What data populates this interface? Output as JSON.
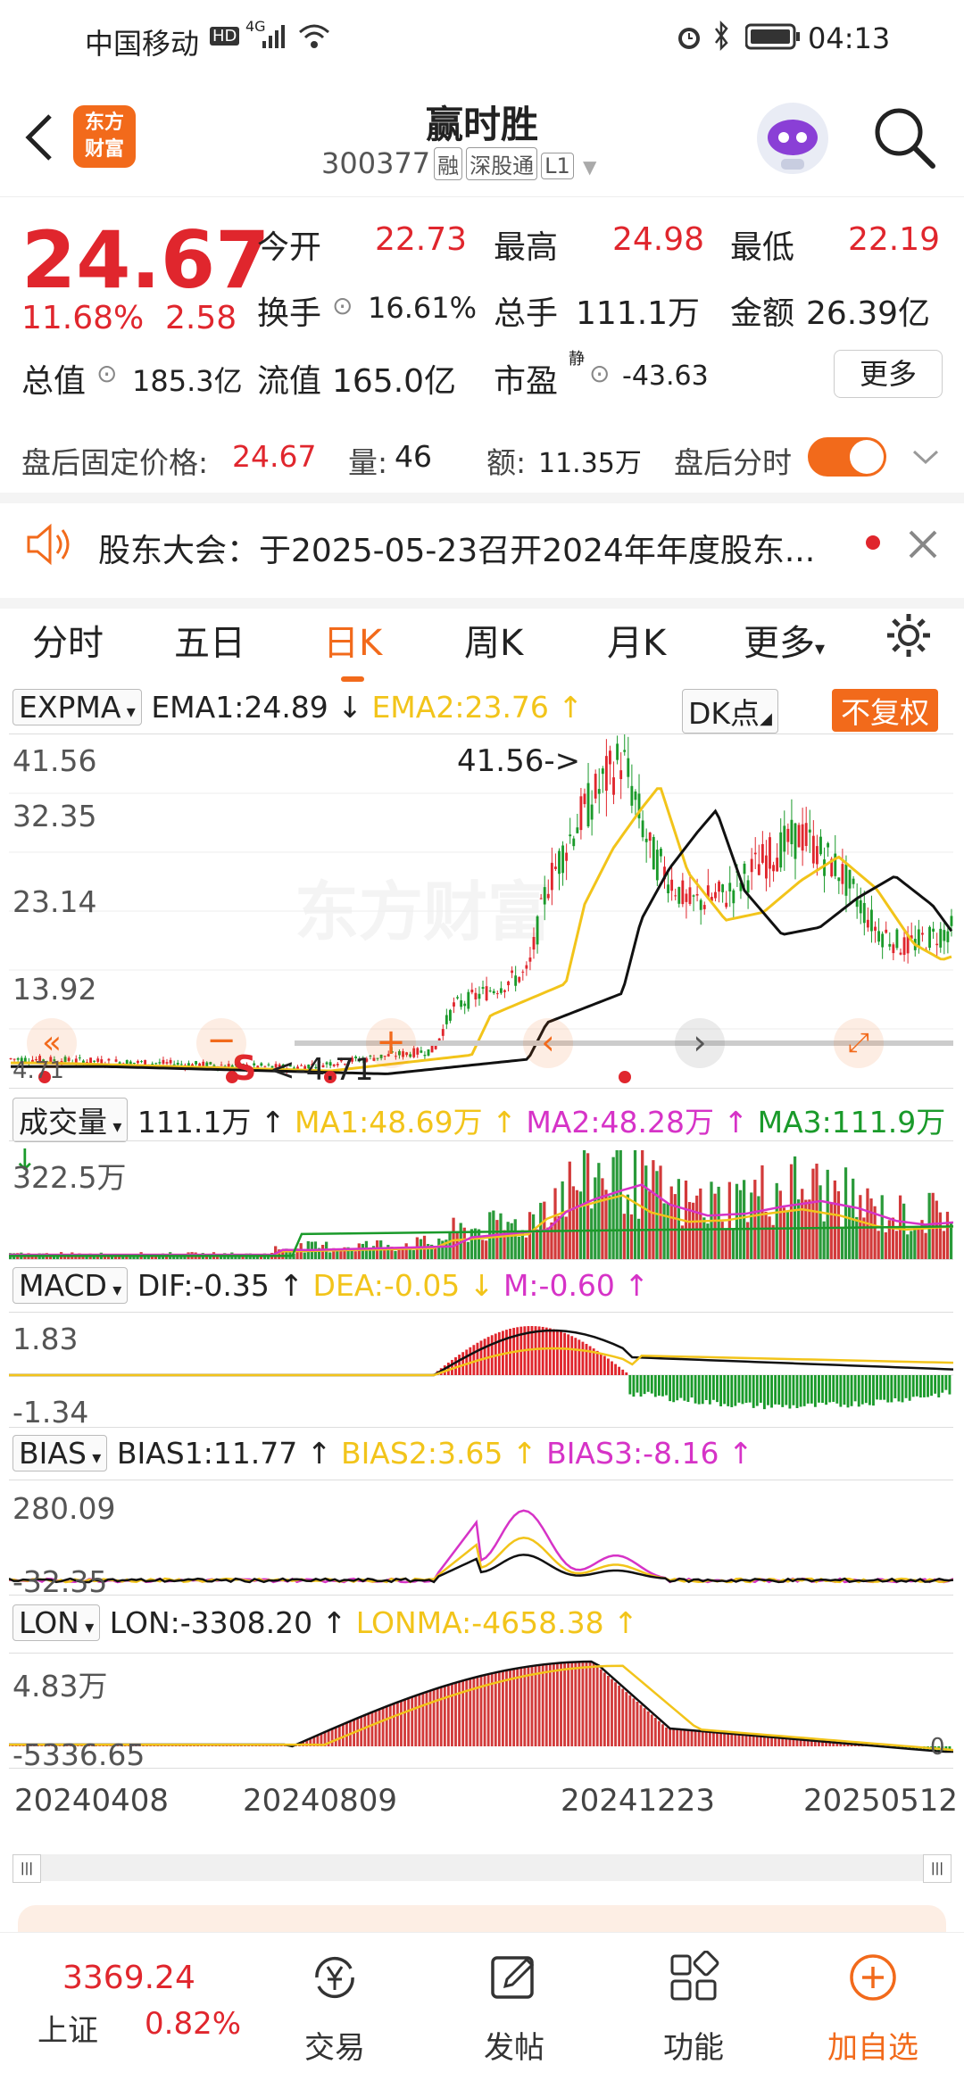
{
  "status_bar": {
    "carrier": "中国移动",
    "hd": "HD",
    "network": "4G",
    "time": "04:13"
  },
  "header": {
    "title": "赢时胜",
    "code": "300377",
    "tags": [
      "融",
      "深股通",
      "L1"
    ],
    "logo_text": [
      "东方",
      "财富"
    ]
  },
  "quote": {
    "price": "24.67",
    "change_pct": "11.68%",
    "change": "2.58",
    "open_label": "今开",
    "open": "22.73",
    "high_label": "最高",
    "high": "24.98",
    "low_label": "最低",
    "low": "22.19",
    "turnover_label": "换手",
    "turnover": "16.61%",
    "volume_label": "总手",
    "volume": "111.1万",
    "amount_label": "金额",
    "amount": "26.39亿",
    "mktcap_label": "总值",
    "mktcap": "185.3亿",
    "float_label": "流值",
    "float": "165.0亿",
    "pe_label": "市盈",
    "pe_sup": "静",
    "pe": "-43.63",
    "more": "更多"
  },
  "after_hours": {
    "label": "盘后固定价格:",
    "price": "24.67",
    "vol_label": "量:",
    "vol": "46",
    "amt_label": "额:",
    "amt": "11.35万",
    "toggle_label": "盘后分时"
  },
  "notice": {
    "text": "股东大会：于2025-05-23召开2024年年度股东..."
  },
  "tabs": [
    "分时",
    "五日",
    "日K",
    "周K",
    "月K",
    "更多"
  ],
  "active_tab": "日K",
  "main_chart": {
    "indicator": "EXPMA",
    "ema1": "EMA1:24.89",
    "ema2": "EMA2:23.76",
    "dk": "DK点",
    "fq": "不复权",
    "y_labels": [
      "41.56",
      "32.35",
      "23.14",
      "13.92",
      "4.71"
    ],
    "max_note": "41.56->",
    "min_note": "<-4.71",
    "s_mark": "S",
    "watermark": "东方财富"
  },
  "vol_chart": {
    "indicator": "成交量",
    "val": "111.1万",
    "ma1": "MA1:48.69万",
    "ma2": "MA2:48.28万",
    "ma3": "MA3:111.9万",
    "top": "322.5万"
  },
  "macd_chart": {
    "indicator": "MACD",
    "dif": "DIF:-0.35",
    "dea": "DEA:-0.05",
    "m": "M:-0.60",
    "top": "1.83",
    "bottom": "-1.34"
  },
  "bias_chart": {
    "indicator": "BIAS",
    "b1": "BIAS1:11.77",
    "b2": "BIAS2:3.65",
    "b3": "BIAS3:-8.16",
    "top": "280.09",
    "bottom": "-32.35"
  },
  "lon_chart": {
    "indicator": "LON",
    "lon": "LON:-3308.20",
    "lonma": "LONMA:-4658.38",
    "top": "4.83万",
    "bottom": "-5336.65",
    "zero": "0"
  },
  "dates": [
    "20240408",
    "20240809",
    "20241223",
    "20250512"
  ],
  "bottom_nav": {
    "index_value": "3369.24",
    "index_name": "上证",
    "index_change": "0.82%",
    "items": [
      "交易",
      "发帖",
      "功能",
      "加自选"
    ]
  },
  "colors": {
    "up": "#e0262d",
    "down": "#1a9a2a",
    "accent": "#f26a1b",
    "ema2": "#f2c41a",
    "ma2": "#d633c7"
  }
}
